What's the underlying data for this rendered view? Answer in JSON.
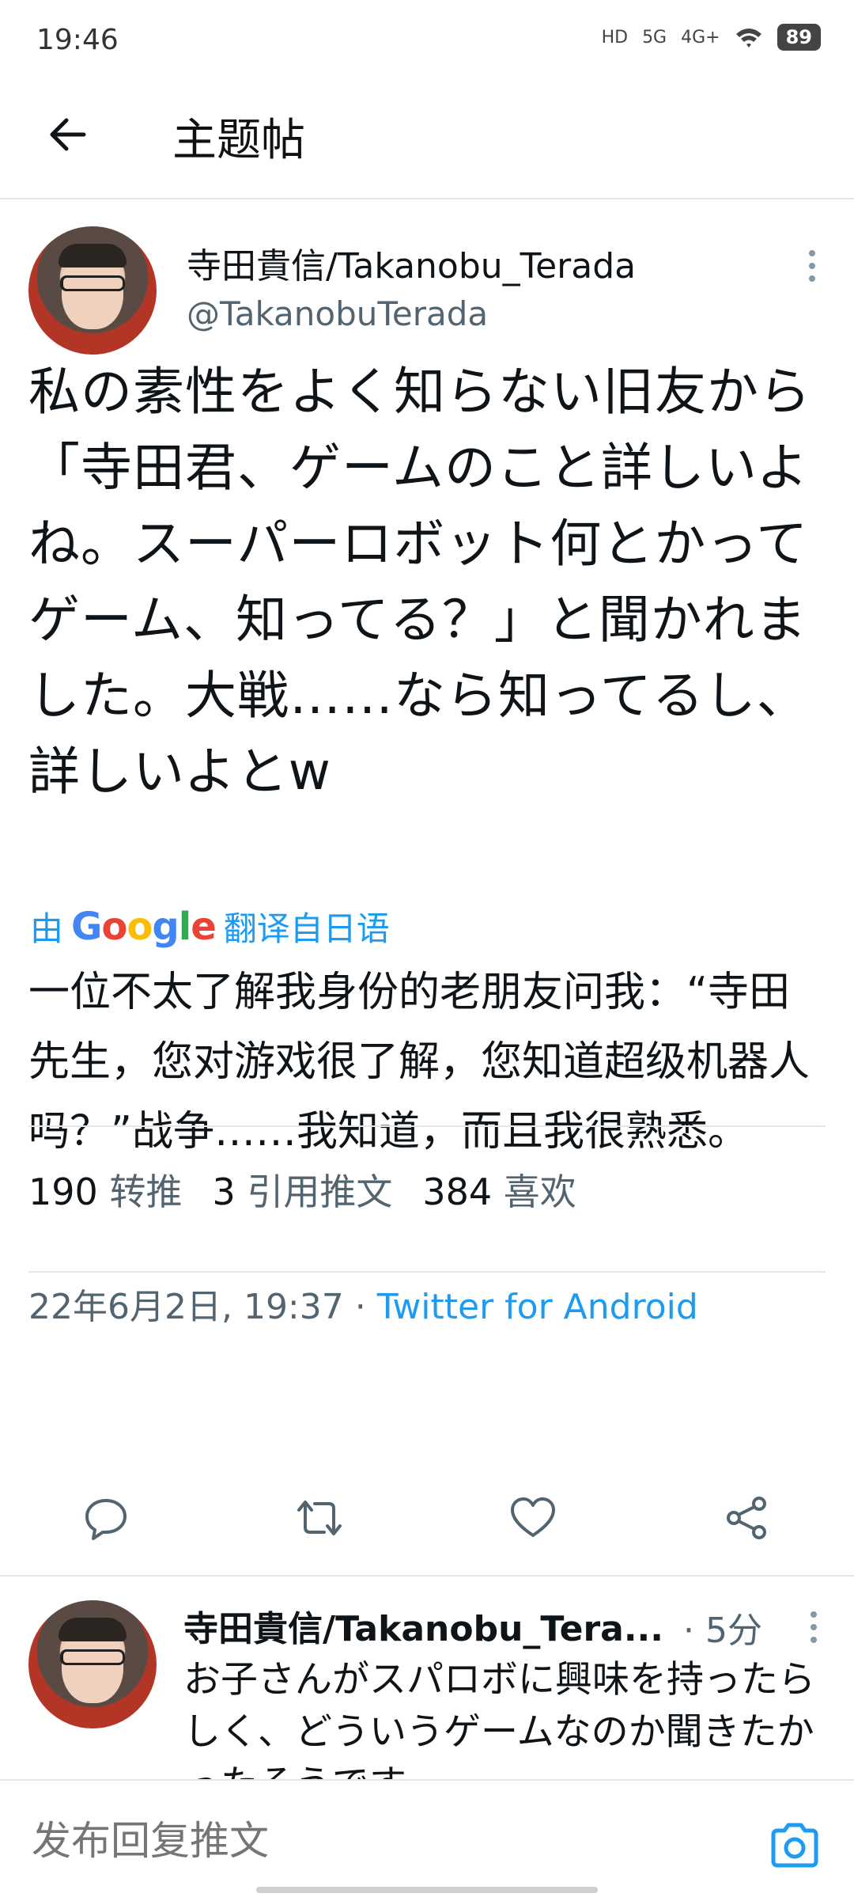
{
  "status_bar": {
    "time": "19:46",
    "hd": "HD",
    "net1": "5G",
    "net2": "4G+",
    "battery": "89"
  },
  "header": {
    "title": "主题帖"
  },
  "tweet": {
    "author_name": "寺田貴信/Takanobu_Terada",
    "author_handle": "@TakanobuTerada",
    "text": "私の素性をよく知らない旧友から「寺田君、ゲームのこと詳しいよね。スーパーロボット何とかってゲーム、知ってる？」と聞かれました。大戦……なら知ってるし、詳しいよとw",
    "translate_prefix": "由",
    "translate_suffix": "翻译自日语",
    "translated_text": "一位不太了解我身份的老朋友问我：“寺田先生，您对游戏很了解，您知道超级机器人吗？”战争……我知道，而且我很熟悉。",
    "date": "22年6月2日, 19:37 · ",
    "source": "Twitter for Android",
    "retweets_count": "190",
    "retweets_label": "转推",
    "quotes_count": "3",
    "quotes_label": "引用推文",
    "likes_count": "384",
    "likes_label": "喜欢"
  },
  "reply": {
    "author_name": "寺田貴信/Takanobu_Tera...",
    "time": "· 5分",
    "text": "お子さんがスパロボに興味を持ったらしく、どういうゲームなのか聞きたかったそうです。"
  },
  "composer": {
    "placeholder": "发布回复推文"
  },
  "icons": [
    "back-arrow-icon",
    "more-icon",
    "reply-icon",
    "retweet-icon",
    "like-icon",
    "share-icon",
    "camera-icon"
  ],
  "colors": {
    "accent": "#1d9bf0",
    "secondary_text": "#536471"
  }
}
